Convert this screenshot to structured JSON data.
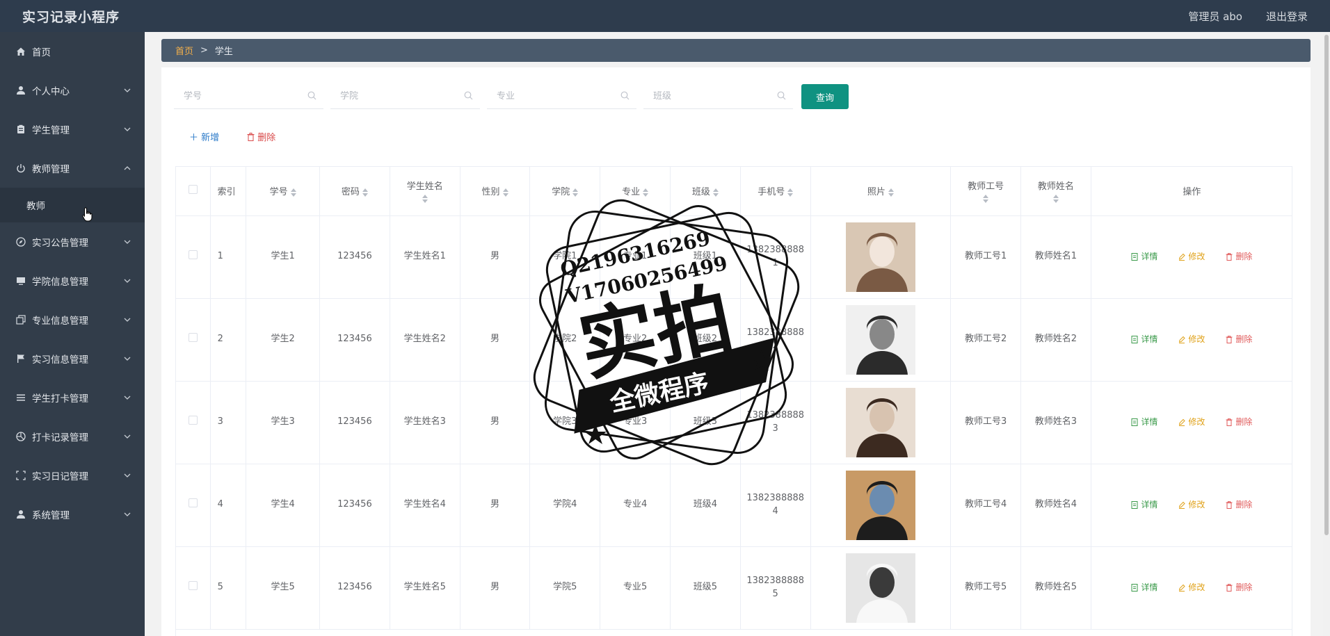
{
  "app": {
    "title": "实习记录小程序",
    "user_label": "管理员 abo",
    "logout_label": "退出登录"
  },
  "sidebar": {
    "items": [
      {
        "label": "首页",
        "icon": "home-icon",
        "expandable": false
      },
      {
        "label": "个人中心",
        "icon": "user-icon",
        "expandable": true
      },
      {
        "label": "学生管理",
        "icon": "clipboard-icon",
        "expandable": true
      },
      {
        "label": "教师管理",
        "icon": "power-icon",
        "expandable": true,
        "expanded": true
      },
      {
        "label": "实习公告管理",
        "icon": "compass-icon",
        "expandable": true
      },
      {
        "label": "学院信息管理",
        "icon": "monitor-icon",
        "expandable": true
      },
      {
        "label": "专业信息管理",
        "icon": "copy-icon",
        "expandable": true
      },
      {
        "label": "实习信息管理",
        "icon": "flag-icon",
        "expandable": true
      },
      {
        "label": "学生打卡管理",
        "icon": "menu-icon",
        "expandable": true
      },
      {
        "label": "打卡记录管理",
        "icon": "aperture-icon",
        "expandable": true
      },
      {
        "label": "实习日记管理",
        "icon": "fullscreen-icon",
        "expandable": true
      },
      {
        "label": "系统管理",
        "icon": "user-icon",
        "expandable": true
      }
    ],
    "submenu": {
      "label": "教师"
    }
  },
  "breadcrumb": {
    "home": "首页",
    "separator": ">",
    "current": "学生"
  },
  "search": {
    "fields": [
      {
        "placeholder": "学号"
      },
      {
        "placeholder": "学院"
      },
      {
        "placeholder": "专业"
      },
      {
        "placeholder": "班级"
      }
    ],
    "query_label": "查询"
  },
  "toolbar": {
    "add_label": "新增",
    "delete_label": "删除"
  },
  "table": {
    "columns": [
      "索引",
      "学号",
      "密码",
      "学生姓名",
      "性别",
      "学院",
      "专业",
      "班级",
      "手机号",
      "照片",
      "教师工号",
      "教师姓名",
      "操作"
    ],
    "rows": [
      {
        "idx": "1",
        "xuehao": "学生1",
        "mima": "123456",
        "xingming": "学生姓名1",
        "xingbie": "男",
        "xueyuan": "学院1",
        "zhuanye": "专业1",
        "banji": "班级1",
        "phone": "13823888881",
        "gonghao": "教师工号1",
        "jiaoshi": "教师姓名1"
      },
      {
        "idx": "2",
        "xuehao": "学生2",
        "mima": "123456",
        "xingming": "学生姓名2",
        "xingbie": "男",
        "xueyuan": "学院2",
        "zhuanye": "专业2",
        "banji": "班级2",
        "phone": "13823888882",
        "gonghao": "教师工号2",
        "jiaoshi": "教师姓名2"
      },
      {
        "idx": "3",
        "xuehao": "学生3",
        "mima": "123456",
        "xingming": "学生姓名3",
        "xingbie": "男",
        "xueyuan": "学院3",
        "zhuanye": "专业3",
        "banji": "班级3",
        "phone": "13823888883",
        "gonghao": "教师工号3",
        "jiaoshi": "教师姓名3"
      },
      {
        "idx": "4",
        "xuehao": "学生4",
        "mima": "123456",
        "xingming": "学生姓名4",
        "xingbie": "男",
        "xueyuan": "学院4",
        "zhuanye": "专业4",
        "banji": "班级4",
        "phone": "13823888884",
        "gonghao": "教师工号4",
        "jiaoshi": "教师姓名4"
      },
      {
        "idx": "5",
        "xuehao": "学生5",
        "mima": "123456",
        "xingming": "学生姓名5",
        "xingbie": "男",
        "xueyuan": "学院5",
        "zhuanye": "专业5",
        "banji": "班级5",
        "phone": "13823888885",
        "gonghao": "教师工号5",
        "jiaoshi": "教师姓名5"
      }
    ],
    "ops": {
      "detail": "详情",
      "edit": "修改",
      "delete": "删除"
    }
  },
  "watermark": {
    "line1": "Q2196316269",
    "line2": "V17060256499",
    "big": "实拍",
    "banner": "全微程序"
  },
  "colors": {
    "topbar": "#2e3c4d",
    "sidebar": "#323d4a",
    "breadcrumb": "#4a5a6c",
    "query_button": "#0f9281",
    "detail": "#3a9a4a",
    "edit": "#e0a21a",
    "delete": "#e05a5a"
  }
}
